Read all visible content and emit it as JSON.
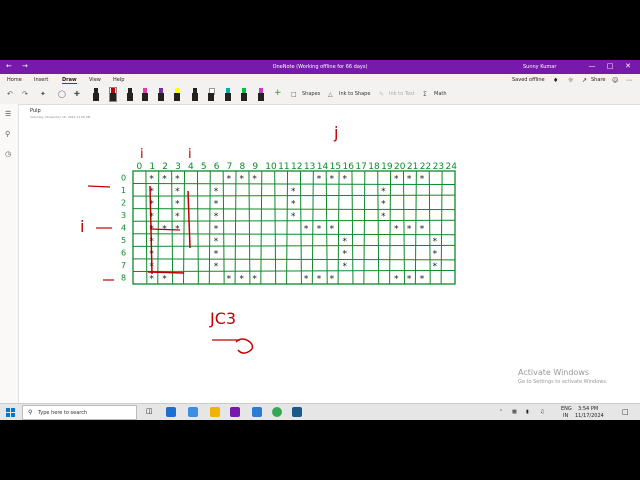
{
  "window": {
    "title": "OneNote (Working offline for 66 days)",
    "user": "Sunny Kumar",
    "nav_back": "←",
    "nav_forward": "→",
    "min": "—",
    "max": "□",
    "close": "✕"
  },
  "menu": {
    "items": [
      "Home",
      "Insert",
      "Draw",
      "View",
      "Help"
    ],
    "active": "Draw",
    "saved": "Saved offline",
    "share": "Share"
  },
  "toolbar": {
    "shapes": "Shapes",
    "ink_to_shape": "Ink to Shape",
    "ink_to_text": "Ink to Text",
    "math": "Math",
    "pen_colors": [
      "#222222",
      "#c00000",
      "#222222",
      "#e040a0",
      "#7030a0",
      "#ffff00",
      "#222222",
      "#ffffff",
      "#00b0b0",
      "#00c040",
      "#c040c0"
    ]
  },
  "page": {
    "title": "Pulp",
    "date": "Saturday, November 16, 2024    11:56 PM"
  },
  "ink": {
    "i_mark_top": "i",
    "i_mark_top2": "i",
    "j_label": "j",
    "i_label": "i",
    "columns": [
      "0",
      "1",
      "2",
      "3",
      "4",
      "5",
      "6",
      "7",
      "8",
      "9",
      "10",
      "11",
      "12",
      "13",
      "14",
      "15",
      "16",
      "17",
      "18",
      "19",
      "20",
      "21",
      "22",
      "23",
      "24"
    ],
    "rows": [
      "0",
      "1",
      "2",
      "3",
      "4",
      "5",
      "6",
      "7",
      "8"
    ],
    "formula": "JC3",
    "grid_color": "#0a8a2a",
    "accent_color": "#c00000"
  },
  "watermark": {
    "line1": "Activate Windows",
    "line2": "Go to Settings to activate Windows."
  },
  "taskbar": {
    "search_placeholder": "Type here to search",
    "lang": "ENG",
    "region": "IN",
    "time": "3:54 PM",
    "date": "11/17/2024"
  }
}
